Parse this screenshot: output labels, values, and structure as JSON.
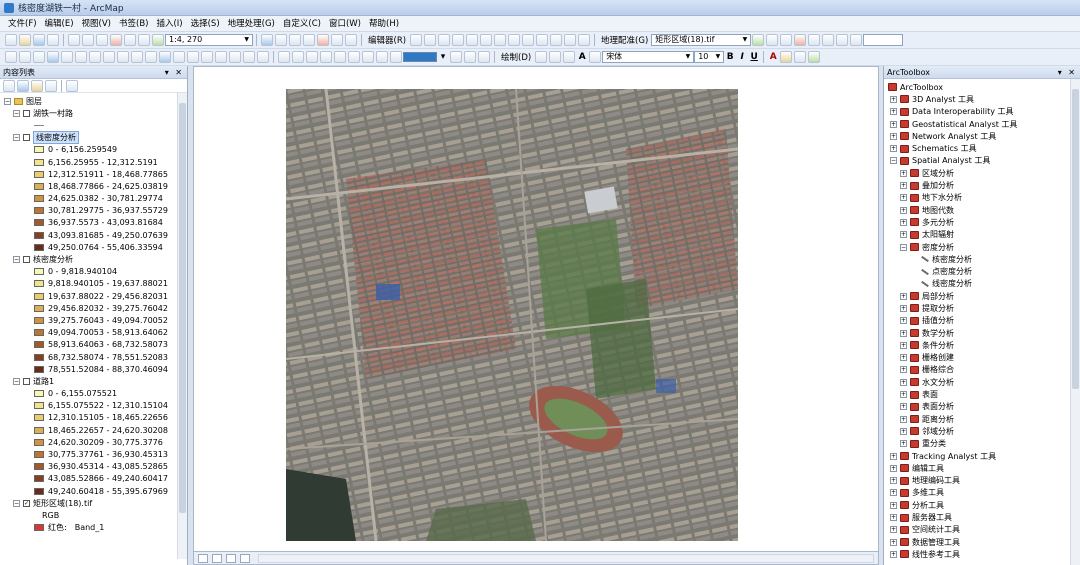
{
  "window": {
    "title": "核密度湖铁一村 - ArcMap"
  },
  "menubar": {
    "items": [
      "文件(F)",
      "编辑(E)",
      "视图(V)",
      "书签(B)",
      "插入(I)",
      "选择(S)",
      "地理处理(G)",
      "自定义(C)",
      "窗口(W)",
      "帮助(H)"
    ]
  },
  "toolbar": {
    "scale": "1:4, 270",
    "editor_label": "编辑器(R)",
    "georef_label": "地理配准(G)",
    "georef_layer": "矩形区域(18).tif",
    "draw_label": "绘制(D)",
    "font_name": "宋体",
    "font_size": "10",
    "bold": "B",
    "italic": "I",
    "underline": "U",
    "text_tool": "A"
  },
  "toc": {
    "title": "内容列表",
    "root_label": "图层",
    "layers": [
      {
        "name": "湖铁一村路",
        "checked": false,
        "symbol": "line",
        "classes": []
      },
      {
        "name": "线密度分析",
        "checked": false,
        "selected": true,
        "classes": [
          {
            "label": "0 - 6,156.259549",
            "color": "#f7f7b4"
          },
          {
            "label": "6,156.25955 - 12,312.5191",
            "color": "#f0e48a"
          },
          {
            "label": "12,312.51911 - 18,468.77865",
            "color": "#e8cc6d"
          },
          {
            "label": "18,468.77866 - 24,625.03819",
            "color": "#dcae55"
          },
          {
            "label": "24,625.0382 - 30,781.29774",
            "color": "#cf9443"
          },
          {
            "label": "30,781.29775 - 36,937.55729",
            "color": "#bb7636"
          },
          {
            "label": "36,937.5573 - 43,093.81684",
            "color": "#a2592b"
          },
          {
            "label": "43,093.81685 - 49,250.07639",
            "color": "#854023"
          },
          {
            "label": "49,250.0764 - 55,406.33594",
            "color": "#6a2b1c"
          }
        ]
      },
      {
        "name": "核密度分析",
        "checked": false,
        "classes": [
          {
            "label": "0 - 9,818.940104",
            "color": "#f7f7b4"
          },
          {
            "label": "9,818.940105 - 19,637.88021",
            "color": "#f0e48a"
          },
          {
            "label": "19,637.88022 - 29,456.82031",
            "color": "#e8cc6d"
          },
          {
            "label": "29,456.82032 - 39,275.76042",
            "color": "#dcae55"
          },
          {
            "label": "39,275.76043 - 49,094.70052",
            "color": "#cf9443"
          },
          {
            "label": "49,094.70053 - 58,913.64062",
            "color": "#bb7636"
          },
          {
            "label": "58,913.64063 - 68,732.58073",
            "color": "#a2592b"
          },
          {
            "label": "68,732.58074 - 78,551.52083",
            "color": "#854023"
          },
          {
            "label": "78,551.52084 - 88,370.46094",
            "color": "#6a2b1c"
          }
        ]
      },
      {
        "name": "道路1",
        "checked": false,
        "classes": [
          {
            "label": "0 - 6,155.075521",
            "color": "#f7f7b4"
          },
          {
            "label": "6,155.075522 - 12,310.15104",
            "color": "#f0e48a"
          },
          {
            "label": "12,310.15105 - 18,465.22656",
            "color": "#e8cc6d"
          },
          {
            "label": "18,465.22657 - 24,620.30208",
            "color": "#dcae55"
          },
          {
            "label": "24,620.30209 - 30,775.3776",
            "color": "#cf9443"
          },
          {
            "label": "30,775.37761 - 36,930.45313",
            "color": "#bb7636"
          },
          {
            "label": "36,930.45314 - 43,085.52865",
            "color": "#a2592b"
          },
          {
            "label": "43,085.52866 - 49,240.60417",
            "color": "#854023"
          },
          {
            "label": "49,240.60418 - 55,395.67969",
            "color": "#6a2b1c"
          }
        ]
      },
      {
        "name": "矩形区域(18).tif",
        "checked": true,
        "rgb_label": "RGB",
        "band_label": "红色:",
        "band_value": "Band_1"
      }
    ]
  },
  "toolbox": {
    "title": "ArcToolbox",
    "root": "ArcToolbox",
    "items": [
      {
        "label": "3D Analyst 工具",
        "level": 1,
        "type": "toolbox",
        "exp": "+"
      },
      {
        "label": "Data Interoperability 工具",
        "level": 1,
        "type": "toolbox",
        "exp": "+"
      },
      {
        "label": "Geostatistical Analyst 工具",
        "level": 1,
        "type": "toolbox",
        "exp": "+"
      },
      {
        "label": "Network Analyst 工具",
        "level": 1,
        "type": "toolbox",
        "exp": "+"
      },
      {
        "label": "Schematics 工具",
        "level": 1,
        "type": "toolbox",
        "exp": "+"
      },
      {
        "label": "Spatial Analyst 工具",
        "level": 1,
        "type": "toolbox",
        "exp": "−"
      },
      {
        "label": "区域分析",
        "level": 2,
        "type": "toolbox",
        "exp": "+"
      },
      {
        "label": "叠加分析",
        "level": 2,
        "type": "toolbox",
        "exp": "+"
      },
      {
        "label": "地下水分析",
        "level": 2,
        "type": "toolbox",
        "exp": "+"
      },
      {
        "label": "地图代数",
        "level": 2,
        "type": "toolbox",
        "exp": "+"
      },
      {
        "label": "多元分析",
        "level": 2,
        "type": "toolbox",
        "exp": "+"
      },
      {
        "label": "太阳辐射",
        "level": 2,
        "type": "toolbox",
        "exp": "+"
      },
      {
        "label": "密度分析",
        "level": 2,
        "type": "toolbox",
        "exp": "−"
      },
      {
        "label": "核密度分析",
        "level": 3,
        "type": "tool"
      },
      {
        "label": "点密度分析",
        "level": 3,
        "type": "tool"
      },
      {
        "label": "线密度分析",
        "level": 3,
        "type": "tool"
      },
      {
        "label": "局部分析",
        "level": 2,
        "type": "toolbox",
        "exp": "+"
      },
      {
        "label": "提取分析",
        "level": 2,
        "type": "toolbox",
        "exp": "+"
      },
      {
        "label": "插值分析",
        "level": 2,
        "type": "toolbox",
        "exp": "+"
      },
      {
        "label": "数学分析",
        "level": 2,
        "type": "toolbox",
        "exp": "+"
      },
      {
        "label": "条件分析",
        "level": 2,
        "type": "toolbox",
        "exp": "+"
      },
      {
        "label": "栅格创建",
        "level": 2,
        "type": "toolbox",
        "exp": "+"
      },
      {
        "label": "栅格综合",
        "level": 2,
        "type": "toolbox",
        "exp": "+"
      },
      {
        "label": "水文分析",
        "level": 2,
        "type": "toolbox",
        "exp": "+"
      },
      {
        "label": "表面",
        "level": 2,
        "type": "toolbox",
        "exp": "+"
      },
      {
        "label": "表面分析",
        "level": 2,
        "type": "toolbox",
        "exp": "+"
      },
      {
        "label": "距离分析",
        "level": 2,
        "type": "toolbox",
        "exp": "+"
      },
      {
        "label": "邻域分析",
        "level": 2,
        "type": "toolbox",
        "exp": "+"
      },
      {
        "label": "重分类",
        "level": 2,
        "type": "toolbox",
        "exp": "+"
      },
      {
        "label": "Tracking Analyst 工具",
        "level": 1,
        "type": "toolbox",
        "exp": "+"
      },
      {
        "label": "编辑工具",
        "level": 1,
        "type": "toolbox",
        "exp": "+"
      },
      {
        "label": "地理编码工具",
        "level": 1,
        "type": "toolbox",
        "exp": "+"
      },
      {
        "label": "多维工具",
        "level": 1,
        "type": "toolbox",
        "exp": "+"
      },
      {
        "label": "分析工具",
        "level": 1,
        "type": "toolbox",
        "exp": "+"
      },
      {
        "label": "服务器工具",
        "level": 1,
        "type": "toolbox",
        "exp": "+"
      },
      {
        "label": "空间统计工具",
        "level": 1,
        "type": "toolbox",
        "exp": "+"
      },
      {
        "label": "数据管理工具",
        "level": 1,
        "type": "toolbox",
        "exp": "+"
      },
      {
        "label": "线性参考工具",
        "level": 1,
        "type": "toolbox",
        "exp": "+"
      }
    ]
  },
  "colors": {
    "accent": "#2f78c4",
    "selection": "#cfe2fb",
    "toolbox_icon": "#c63b2f"
  }
}
